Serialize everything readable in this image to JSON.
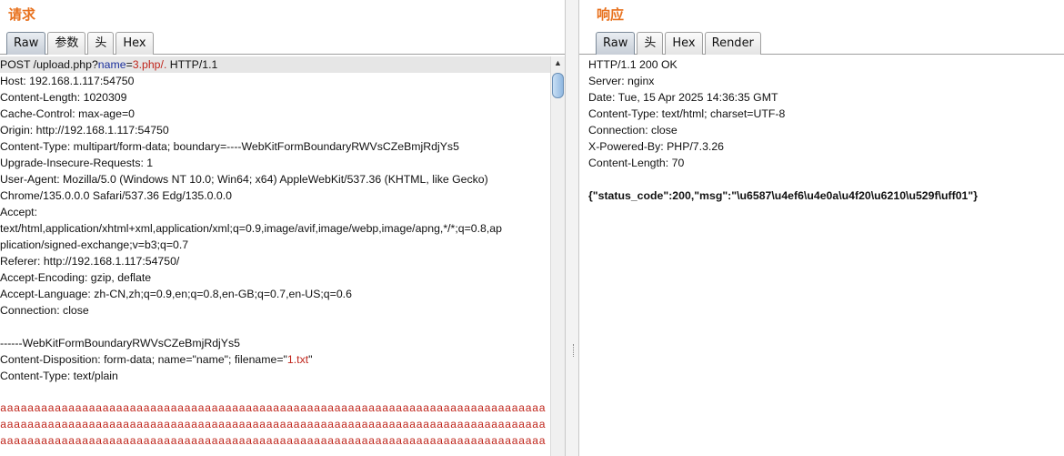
{
  "request": {
    "title": "请求",
    "tabs": [
      "Raw",
      "参数",
      "头",
      "Hex"
    ],
    "active_tab": "Raw",
    "first_line": {
      "pre": "POST /upload.php?",
      "param_name": "name",
      "eq": "=",
      "param_value": "3.php/.",
      "post": " HTTP/1.1"
    },
    "lines": [
      "Host: 192.168.1.117:54750",
      "Content-Length: 1020309",
      "Cache-Control: max-age=0",
      "Origin: http://192.168.1.117:54750",
      "Content-Type: multipart/form-data; boundary=----WebKitFormBoundaryRWVsCZeBmjRdjYs5",
      "Upgrade-Insecure-Requests: 1",
      "User-Agent: Mozilla/5.0 (Windows NT 10.0; Win64; x64) AppleWebKit/537.36 (KHTML, like Gecko)",
      "Chrome/135.0.0.0 Safari/537.36 Edg/135.0.0.0",
      "Accept:",
      "text/html,application/xhtml+xml,application/xml;q=0.9,image/avif,image/webp,image/apng,*/*;q=0.8,ap",
      "plication/signed-exchange;v=b3;q=0.7",
      "Referer: http://192.168.1.117:54750/",
      "Accept-Encoding: gzip, deflate",
      "Accept-Language: zh-CN,zh;q=0.9,en;q=0.8,en-GB;q=0.7,en-US;q=0.6",
      "Connection: close",
      "",
      "------WebKitFormBoundaryRWVsCZeBmjRdjYs5"
    ],
    "disposition": {
      "pre": "Content-Disposition: form-data; name=\"name\"; filename=\"",
      "filename": "1.txt",
      "post": "\""
    },
    "content_type_line": "Content-Type: text/plain",
    "body_lines": [
      "aaaaaaaaaaaaaaaaaaaaaaaaaaaaaaaaaaaaaaaaaaaaaaaaaaaaaaaaaaaaaaaaaaaaaaaaaaaaaaaa",
      "aaaaaaaaaaaaaaaaaaaaaaaaaaaaaaaaaaaaaaaaaaaaaaaaaaaaaaaaaaaaaaaaaaaaaaaaaaaaaaaa",
      "aaaaaaaaaaaaaaaaaaaaaaaaaaaaaaaaaaaaaaaaaaaaaaaaaaaaaaaaaaaaaaaaaaaaaaaaaaaaaaaa"
    ]
  },
  "response": {
    "title": "响应",
    "tabs": [
      "Raw",
      "头",
      "Hex",
      "Render"
    ],
    "active_tab": "Raw",
    "lines": [
      "HTTP/1.1 200 OK",
      "Server: nginx",
      "Date: Tue, 15 Apr 2025 14:36:35 GMT",
      "Content-Type: text/html; charset=UTF-8",
      "Connection: close",
      "X-Powered-By: PHP/7.3.26",
      "Content-Length: 70",
      ""
    ],
    "body": "{\"status_code\":200,\"msg\":\"\\u6587\\u4ef6\\u4e0a\\u4f20\\u6210\\u529f\\uff01\"}"
  },
  "colors": {
    "title_orange": "#e8711d",
    "param_name_blue": "#1a2f9c",
    "param_value_red": "#c0261c",
    "highlight_line": "#e6e6e6"
  }
}
